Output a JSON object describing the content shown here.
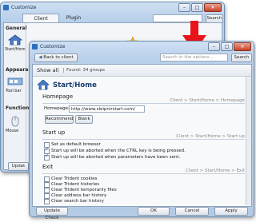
{
  "back_window": {
    "title": "Customize",
    "tabs": [
      "Client",
      "Plugin"
    ],
    "search_button": "Search",
    "sidebar": [
      {
        "heading": "General",
        "item": "Start/Hom"
      },
      {
        "heading": "Appearan",
        "item": "Tool bar"
      },
      {
        "heading": "Functions",
        "item": "Mouse"
      }
    ],
    "update_button": "Updat"
  },
  "front_window": {
    "title": "Customize",
    "back_button": "Back to client",
    "search_placeholder": "Search in the options...",
    "search_button": "Search",
    "show_all": "Show all",
    "found_text": "Found: 34 groups",
    "page_title": "Start/Home",
    "sections": {
      "homepage": {
        "title": "Homepage",
        "crumb": "Client > Start/Home > Homepage",
        "label": "Homepage:",
        "url": "http://www.sleipnirstart.com/",
        "recommend_button": "Recommend",
        "blank_button": "Blank"
      },
      "startup": {
        "title": "Start up",
        "crumb": "Client > Start/Home > Start up",
        "options": [
          {
            "label": "Set as default browser",
            "checked": false
          },
          {
            "label": "Start up will be aborted when the CTRL key is being pressed.",
            "checked": true
          },
          {
            "label": "Start up will be aborted when parameters have been sent.",
            "checked": true
          }
        ]
      },
      "exit": {
        "title": "Exit",
        "crumb": "Client > Start/Home > Exit",
        "options": [
          {
            "label": "Clear Trident cookies",
            "checked": false
          },
          {
            "label": "Clear Trident histories",
            "checked": false
          },
          {
            "label": "Clear Trident temporarily files",
            "checked": false
          },
          {
            "label": "Clear address bar history",
            "checked": false
          },
          {
            "label": "Clear search bar history",
            "checked": false
          }
        ]
      }
    },
    "footer": {
      "update_check": "Update Check",
      "ok": "OK",
      "cancel": "Cancel",
      "apply": "Apply"
    }
  },
  "colors": {
    "arrow": "#e8141a",
    "title_blue": "#1a3d6e"
  },
  "icons": [
    "home-icon",
    "toolbar-icon",
    "mouse-icon",
    "close-icon",
    "maximize-icon",
    "minimize-icon",
    "down-arrow-icon",
    "star-icon"
  ]
}
